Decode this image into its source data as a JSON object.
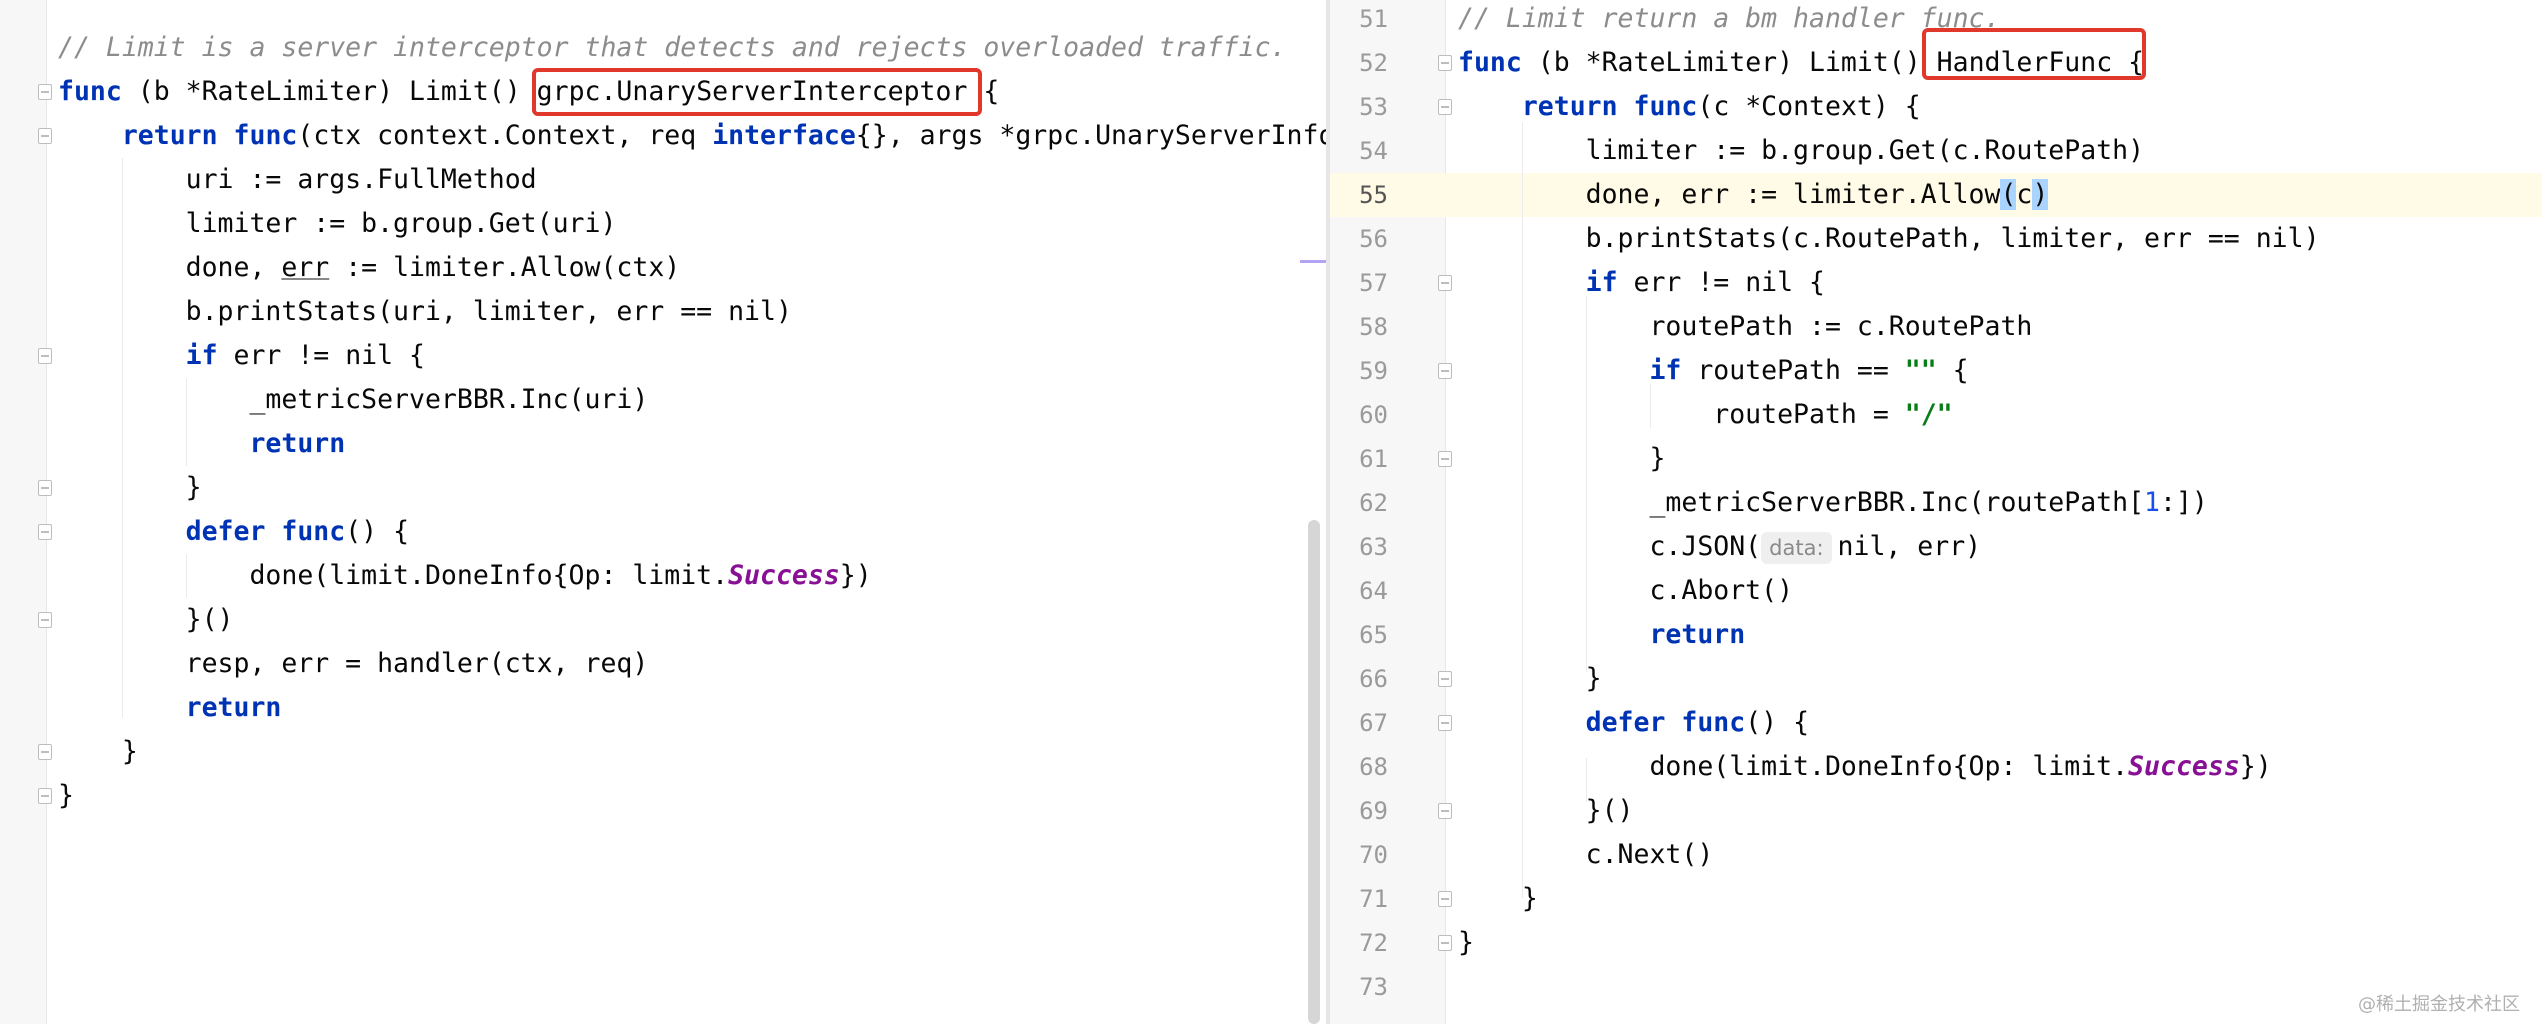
{
  "left_editor": {
    "lines": [
      {
        "segments": [
          {
            "t": "// Limit is a server interceptor that detects and rejects overloaded traffic.",
            "c": "cm"
          }
        ]
      },
      {
        "segments": [
          {
            "t": "func",
            "c": "kw"
          },
          {
            "t": " (b *RateLimiter) Limit() "
          },
          {
            "t": "grpc.UnaryServerInterceptor"
          },
          {
            "t": " {"
          }
        ]
      },
      {
        "segments": [
          {
            "t": "    "
          },
          {
            "t": "return",
            "c": "kw"
          },
          {
            "t": " "
          },
          {
            "t": "func",
            "c": "kw"
          },
          {
            "t": "(ctx context.Context, req "
          },
          {
            "t": "interface",
            "c": "kw"
          },
          {
            "t": "{}, args *grpc.UnaryServerInfo"
          }
        ]
      },
      {
        "segments": [
          {
            "t": "        uri := args.FullMethod"
          }
        ]
      },
      {
        "segments": [
          {
            "t": "        limiter := b.group.Get(uri)"
          }
        ]
      },
      {
        "segments": [
          {
            "t": "        done, "
          },
          {
            "t": "err",
            "c": "underline"
          },
          {
            "t": " := limiter.Allow(ctx)"
          }
        ]
      },
      {
        "segments": [
          {
            "t": "        b.printStats(uri, limiter, err == nil)"
          }
        ]
      },
      {
        "segments": [
          {
            "t": "        "
          },
          {
            "t": "if",
            "c": "kw"
          },
          {
            "t": " err != nil {"
          }
        ]
      },
      {
        "segments": [
          {
            "t": "            _metricServerBBR.Inc(uri)"
          }
        ]
      },
      {
        "segments": [
          {
            "t": "            "
          },
          {
            "t": "return",
            "c": "kw"
          }
        ]
      },
      {
        "segments": [
          {
            "t": "        }"
          }
        ]
      },
      {
        "segments": [
          {
            "t": "        "
          },
          {
            "t": "defer",
            "c": "kw"
          },
          {
            "t": " "
          },
          {
            "t": "func",
            "c": "kw"
          },
          {
            "t": "() {"
          }
        ]
      },
      {
        "segments": [
          {
            "t": "            done(limit.DoneInfo{Op: limit."
          },
          {
            "t": "Success",
            "c": "italic-purple"
          },
          {
            "t": "})"
          }
        ]
      },
      {
        "segments": [
          {
            "t": "        }()"
          }
        ]
      },
      {
        "segments": [
          {
            "t": "        resp, err = handler(ctx, req)"
          }
        ]
      },
      {
        "segments": [
          {
            "t": "        "
          },
          {
            "t": "return",
            "c": "kw"
          }
        ]
      },
      {
        "segments": [
          {
            "t": "    }"
          }
        ]
      },
      {
        "segments": [
          {
            "t": "}"
          }
        ]
      }
    ]
  },
  "right_editor": {
    "line_numbers": [
      "51",
      "52",
      "53",
      "54",
      "55",
      "56",
      "57",
      "58",
      "59",
      "60",
      "61",
      "62",
      "63",
      "64",
      "65",
      "66",
      "67",
      "68",
      "69",
      "70",
      "71",
      "72",
      "73"
    ],
    "current_line": "55",
    "lines": [
      {
        "segments": [
          {
            "t": "// Limit return a bm handler func.",
            "c": "cm"
          }
        ]
      },
      {
        "segments": [
          {
            "t": "func",
            "c": "kw"
          },
          {
            "t": " (b *RateLimiter) Limit() "
          },
          {
            "t": "HandlerFunc"
          },
          {
            "t": " {"
          }
        ]
      },
      {
        "segments": [
          {
            "t": "    "
          },
          {
            "t": "return",
            "c": "kw"
          },
          {
            "t": " "
          },
          {
            "t": "func",
            "c": "kw"
          },
          {
            "t": "(c *Context) {"
          }
        ]
      },
      {
        "segments": [
          {
            "t": "        limiter := b.group.Get(c.RoutePath)"
          }
        ]
      },
      {
        "segments": [
          {
            "t": "        done, err := limiter.Allow"
          },
          {
            "t": "(",
            "c": "brace-hl"
          },
          {
            "t": "c"
          },
          {
            "t": ")",
            "c": "brace-hl"
          }
        ]
      },
      {
        "segments": [
          {
            "t": "        b.printStats(c.RoutePath, limiter, err == nil)"
          }
        ]
      },
      {
        "segments": [
          {
            "t": "        "
          },
          {
            "t": "if",
            "c": "kw"
          },
          {
            "t": " err != nil {"
          }
        ]
      },
      {
        "segments": [
          {
            "t": "            routePath := c.RoutePath"
          }
        ]
      },
      {
        "segments": [
          {
            "t": "            "
          },
          {
            "t": "if",
            "c": "kw"
          },
          {
            "t": " routePath == "
          },
          {
            "t": "\"\"",
            "c": "str"
          },
          {
            "t": " {"
          }
        ]
      },
      {
        "segments": [
          {
            "t": "                routePath = "
          },
          {
            "t": "\"/\"",
            "c": "str"
          }
        ]
      },
      {
        "segments": [
          {
            "t": "            }"
          }
        ]
      },
      {
        "segments": [
          {
            "t": "            _metricServerBBR.Inc(routePath["
          },
          {
            "t": "1",
            "c": "num"
          },
          {
            "t": ":])"
          }
        ]
      },
      {
        "segments": [
          {
            "t": "            c.JSON("
          },
          {
            "t": "data:",
            "c": "param-hint"
          },
          {
            "t": "nil, err)"
          }
        ]
      },
      {
        "segments": [
          {
            "t": "            c.Abort()"
          }
        ]
      },
      {
        "segments": [
          {
            "t": "            "
          },
          {
            "t": "return",
            "c": "kw"
          }
        ]
      },
      {
        "segments": [
          {
            "t": "        }"
          }
        ]
      },
      {
        "segments": [
          {
            "t": "        "
          },
          {
            "t": "defer",
            "c": "kw"
          },
          {
            "t": " "
          },
          {
            "t": "func",
            "c": "kw"
          },
          {
            "t": "() {"
          }
        ]
      },
      {
        "segments": [
          {
            "t": "            done(limit.DoneInfo{Op: limit."
          },
          {
            "t": "Success",
            "c": "italic-purple"
          },
          {
            "t": "})"
          }
        ]
      },
      {
        "segments": [
          {
            "t": "        }()"
          }
        ]
      },
      {
        "segments": [
          {
            "t": "        c.Next()"
          }
        ]
      },
      {
        "segments": [
          {
            "t": "    }"
          }
        ]
      },
      {
        "segments": [
          {
            "t": "}"
          }
        ]
      },
      {
        "segments": [
          {
            "t": ""
          }
        ]
      }
    ]
  },
  "watermark": "@稀土掘金技术社区",
  "colors": {
    "highlight_box": "#e0382a",
    "keyword": "#0033b3",
    "comment": "#8c8c8c",
    "string": "#067d17",
    "current_line_bg": "#fffbe6"
  }
}
